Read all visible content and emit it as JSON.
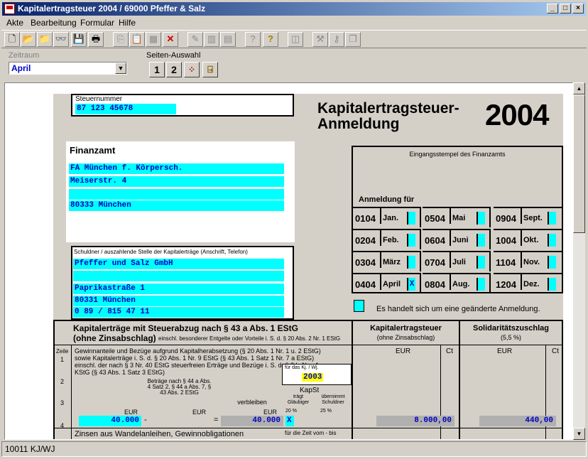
{
  "window": {
    "title": "Kapitalertragsteuer 2004 / 69000 Pfeffer & Salz",
    "min": "_",
    "max": "□",
    "close": "×"
  },
  "menu": [
    "Akte",
    "Bearbeitung",
    "Formular",
    "Hilfe"
  ],
  "filter": {
    "zeitraum_label": "Zeitraum",
    "zeitraum_value": "April",
    "seiten_label": "Seiten-Auswahl",
    "page1": "1",
    "page2": "2"
  },
  "form": {
    "steuernummer_label": "Steuernummer",
    "steuernummer": "87 123 45678",
    "title_line1": "Kapitalertragsteuer-",
    "title_line2": "Anmeldung",
    "year": "2004",
    "finanzamt_label": "Finanzamt",
    "finanzamt_name": "FA München f. Körpersch.",
    "finanzamt_street": "Meiserstr. 4",
    "finanzamt_city": "80333 München",
    "schuldner_label": "Schuldner / auszahlende Stelle der Kapitalerträge (Anschrift, Telefon)",
    "schuldner_name": "Pfeffer und Salz GmbH",
    "schuldner_street": "Paprikastraße 1",
    "schuldner_city": "80331 München",
    "schuldner_phone": "0 89 / 815 47 11",
    "eingangsstempel": "Eingangsstempel des Finanzamts",
    "anmeldung_fuer": "Anmeldung für",
    "months": [
      {
        "code": "0104",
        "name": "Jan.",
        "mark": ""
      },
      {
        "code": "0504",
        "name": "Mai",
        "mark": ""
      },
      {
        "code": "0904",
        "name": "Sept.",
        "mark": ""
      },
      {
        "code": "0204",
        "name": "Feb.",
        "mark": ""
      },
      {
        "code": "0604",
        "name": "Juni",
        "mark": ""
      },
      {
        "code": "1004",
        "name": "Okt.",
        "mark": ""
      },
      {
        "code": "0304",
        "name": "März",
        "mark": ""
      },
      {
        "code": "0704",
        "name": "Juli",
        "mark": ""
      },
      {
        "code": "1104",
        "name": "Nov.",
        "mark": ""
      },
      {
        "code": "0404",
        "name": "April",
        "mark": "X"
      },
      {
        "code": "0804",
        "name": "Aug.",
        "mark": ""
      },
      {
        "code": "1204",
        "name": "Dez.",
        "mark": ""
      }
    ],
    "geaendert_text": "Es handelt sich um eine geänderte Anmeldung.",
    "section_title1": "Kapitalerträge mit Steuerabzug nach § 43 a Abs. 1 EStG",
    "section_title2": "(ohne Zinsabschlag)",
    "section_note": "einschl. besonderer Entgelte oder Vorteile i. S. d. § 20 Abs. 2 Nr. 1 EStG",
    "col_kapst_title": "Kapitalertragsteuer",
    "col_kapst_sub": "(ohne Zinsabschlag)",
    "col_soli_title": "Solidaritätszuschlag",
    "col_soli_sub": "(5,5 %)",
    "zeile_label": "Zeile",
    "eur": "EUR",
    "ct": "Ct",
    "line1_text": "Gewinnanteile und Bezüge aufgrund Kapitalherabsetzung (§ 20 Abs. 1 Nr. 1 u. 2 EStG) sowie Kapitalerträge i. S. d. § 20 Abs. 1 Nr. 9 EStG (§ 43 Abs. 1 Satz 1 Nr. 7 a EStG) einschl. der nach § 3 Nr. 40 EStG steuerfreien Erträge und Bezüge i. S. d. § 8 b Abs. 1 KStG (§ 43 Abs. 1 Satz 3 EStG)",
    "fuer_kj": "für das Kj. / Wj.",
    "kj_value": "2003",
    "betraege_nach": "Beträge nach § 44 a Abs. 4 Satz 2, § 44 a Abs. 7, § 43 Abs. 2 EStG",
    "verbleiben": "verbleiben",
    "kapst_label": "KapSt",
    "traegt": "trägt Gläubiger",
    "uebernimmt": "übernimmt Schuldner",
    "pct20": "20 %",
    "pct25": "25 %",
    "row4_amount": "40.000",
    "row4_minus": "-",
    "row4_eq": "=",
    "row4_remain": "40.000",
    "row4_x": "X",
    "row4_kapst": "8.000,00",
    "row4_soli": "440,00",
    "line5_text": "Zinsen aus Wandelanleihen, Gewinnobligationen",
    "zeit_vom": "für die Zeit vom - bis",
    "zeilen": [
      "1",
      "2",
      "3",
      "4"
    ]
  },
  "status": "10011 KJ/WJ"
}
